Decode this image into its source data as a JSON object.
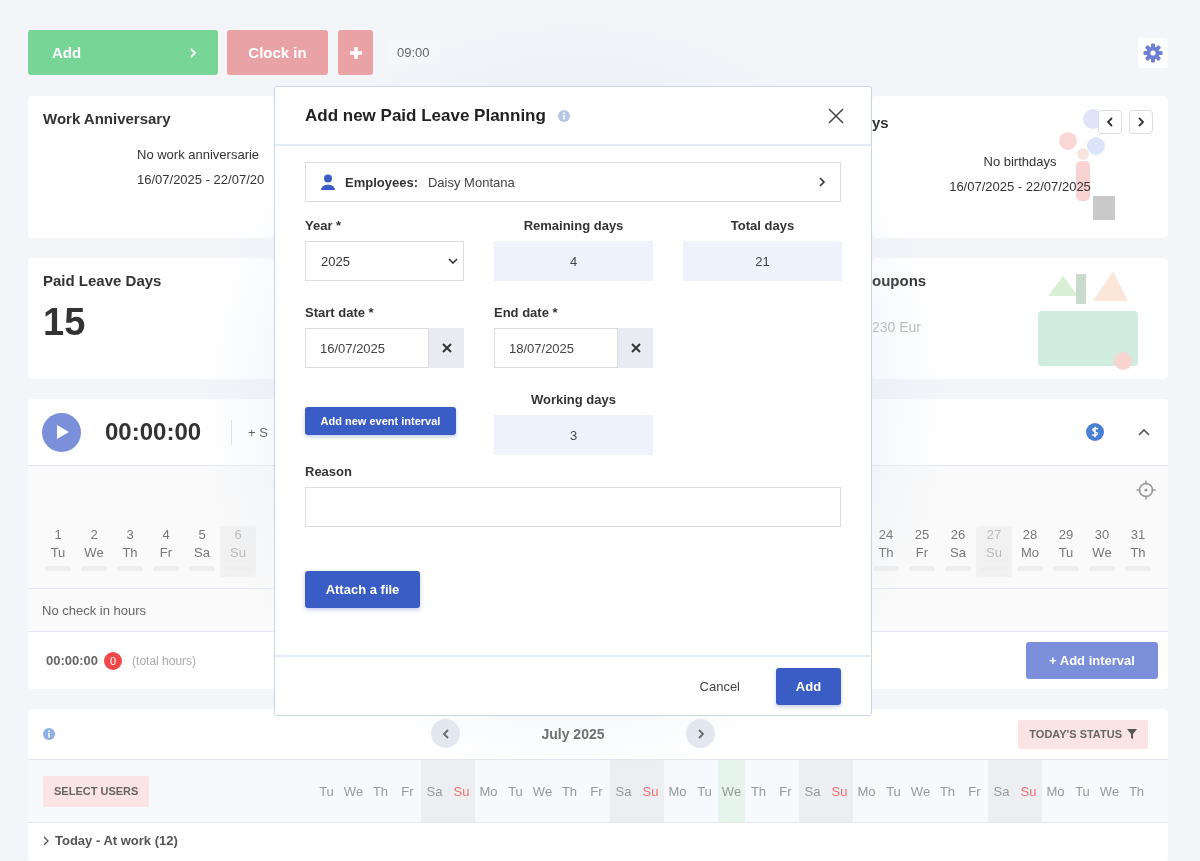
{
  "toolbar": {
    "add_button": "Add",
    "clock_in_button": "Clock in",
    "time": "09:00"
  },
  "cards_top": [
    {
      "title": "Work Anniversary",
      "message": "No work anniversarie",
      "range": "16/07/2025 - 22/07/20"
    },
    {
      "title": "ys",
      "message": "No birthdays",
      "range": "16/07/2025 - 22/07/2025"
    }
  ],
  "cards_middle": [
    {
      "title": "Paid Leave Days",
      "value": "15"
    },
    {
      "title": "oupons",
      "value": "230 Eur"
    }
  ],
  "timer": {
    "time": "00:00:00",
    "set_link": "+ S",
    "expanded": true,
    "days_left": [
      {
        "day": "1",
        "weekday": "Tu",
        "weekend": false
      },
      {
        "day": "2",
        "weekday": "We",
        "weekend": false
      },
      {
        "day": "3",
        "weekday": "Th",
        "weekend": false
      },
      {
        "day": "4",
        "weekday": "Fr",
        "weekend": false
      },
      {
        "day": "5",
        "weekday": "Sa",
        "weekend": false
      },
      {
        "day": "6",
        "weekday": "Su",
        "weekend": true
      }
    ],
    "days_right": [
      {
        "day": "24",
        "weekday": "Th",
        "weekend": false
      },
      {
        "day": "25",
        "weekday": "Fr",
        "weekend": false
      },
      {
        "day": "26",
        "weekday": "Sa",
        "weekend": false
      },
      {
        "day": "27",
        "weekday": "Su",
        "weekend": true
      },
      {
        "day": "28",
        "weekday": "Mo",
        "weekend": false
      },
      {
        "day": "29",
        "weekday": "Tu",
        "weekend": false
      },
      {
        "day": "30",
        "weekday": "We",
        "weekend": false
      },
      {
        "day": "31",
        "weekday": "Th",
        "weekend": false
      }
    ],
    "no_check_in": "No check in hours",
    "total": "00:00:00",
    "count": "0",
    "total_label": "(total hours)",
    "add_interval_button": "+  Add interval"
  },
  "calendar": {
    "month": "July 2025",
    "status_button": "TODAY'S STATUS",
    "select_users_button": "SELECT USERS",
    "weekdays": [
      {
        "label": "Tu",
        "kind": "workday"
      },
      {
        "label": "We",
        "kind": "workday"
      },
      {
        "label": "Th",
        "kind": "workday"
      },
      {
        "label": "Fr",
        "kind": "workday"
      },
      {
        "label": "Sa",
        "kind": "saturday"
      },
      {
        "label": "Su",
        "kind": "sunday"
      },
      {
        "label": "Mo",
        "kind": "workday"
      },
      {
        "label": "Tu",
        "kind": "workday"
      },
      {
        "label": "We",
        "kind": "workday"
      },
      {
        "label": "Th",
        "kind": "workday"
      },
      {
        "label": "Fr",
        "kind": "workday"
      },
      {
        "label": "Sa",
        "kind": "saturday"
      },
      {
        "label": "Su",
        "kind": "sunday"
      },
      {
        "label": "Mo",
        "kind": "workday"
      },
      {
        "label": "Tu",
        "kind": "workday"
      },
      {
        "label": "We",
        "kind": "today"
      },
      {
        "label": "Th",
        "kind": "workday"
      },
      {
        "label": "Fr",
        "kind": "workday"
      },
      {
        "label": "Sa",
        "kind": "saturday"
      },
      {
        "label": "Su",
        "kind": "sunday"
      },
      {
        "label": "Mo",
        "kind": "workday"
      },
      {
        "label": "Tu",
        "kind": "workday"
      },
      {
        "label": "We",
        "kind": "workday"
      },
      {
        "label": "Th",
        "kind": "workday"
      },
      {
        "label": "Fr",
        "kind": "workday"
      },
      {
        "label": "Sa",
        "kind": "saturday"
      },
      {
        "label": "Su",
        "kind": "sunday"
      },
      {
        "label": "Mo",
        "kind": "workday"
      },
      {
        "label": "Tu",
        "kind": "workday"
      },
      {
        "label": "We",
        "kind": "workday"
      },
      {
        "label": "Th",
        "kind": "workday"
      }
    ],
    "groups": [
      {
        "label": "Today - At work (12)",
        "expanded": false
      }
    ]
  },
  "modal": {
    "title": "Add new Paid Leave Planning",
    "employees_label": "Employees:",
    "employees_value": "Daisy Montana",
    "year_label": "Year *",
    "year_value": "2025",
    "remaining_label": "Remaining days",
    "remaining_value": "4",
    "total_label": "Total days",
    "total_value": "21",
    "start_label": "Start date  *",
    "start_value": "16/07/2025",
    "end_label": "End date *",
    "end_value": "18/07/2025",
    "interval_button": "Add new event interval",
    "working_label": "Working days",
    "working_value": "3",
    "reason_label": "Reason",
    "attach_button": "Attach a file",
    "cancel_button": "Cancel",
    "add_button": "Add"
  }
}
